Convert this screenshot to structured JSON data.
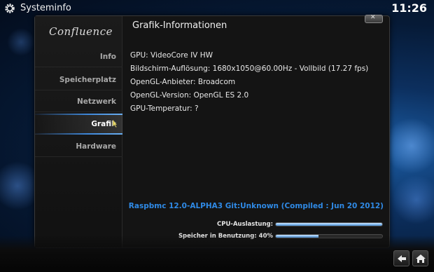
{
  "topbar": {
    "title": "Systeminfo",
    "time": "11:26"
  },
  "logo": {
    "text": "Confluence"
  },
  "sidebar": {
    "items": [
      {
        "label": "Info"
      },
      {
        "label": "Speicherplatz"
      },
      {
        "label": "Netzwerk"
      },
      {
        "label": "Grafik",
        "active": true
      },
      {
        "label": "Hardware"
      }
    ]
  },
  "content": {
    "title": "Grafik-Informationen",
    "lines": [
      "GPU: VideoCore IV HW",
      "Bildschirm-Auflösung: 1680x1050@60.00Hz - Vollbild (17.27 fps)",
      "OpenGL-Anbieter: Broadcom",
      "OpenGL-Version:  OpenGL ES 2.0",
      "GPU-Temperatur: ?"
    ],
    "build": "Raspbmc 12.0-ALPHA3 Git:Unknown (Compiled : Jun 20 2012)"
  },
  "stats": {
    "cpu_label": "CPU-Auslastung:",
    "cpu_fraction": 1.0,
    "memory_label": "Speicher in Benutzung: 40%",
    "memory_fraction": 0.4
  },
  "icons": {
    "top_left": "gear-icon",
    "close": "close-icon",
    "back": "back-arrow-icon",
    "home": "home-icon"
  },
  "colors": {
    "accent": "#2f8ae6",
    "background": "#061a36",
    "dialog": "#141414"
  }
}
